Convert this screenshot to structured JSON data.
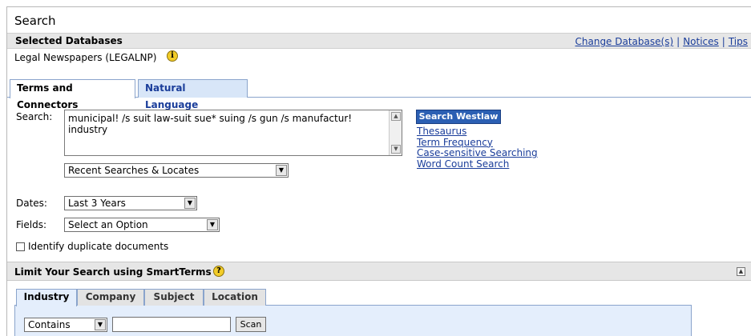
{
  "page": {
    "title": "Search"
  },
  "databases": {
    "header": "Selected Databases",
    "selected": "Legal Newspapers (LEGALNP)",
    "links": [
      "Change Database(s)",
      "Notices",
      "Tips"
    ]
  },
  "tabs": [
    {
      "label": "Terms and Connectors",
      "active": true
    },
    {
      "label": "Natural Language",
      "active": false
    }
  ],
  "search": {
    "label": "Search:",
    "query": "municipal! /s suit law-suit sue* suing /s gun /s manufactur!\nindustry",
    "button": "Search Westlaw",
    "links": [
      "Thesaurus",
      "Term Frequency",
      "Case-sensitive Searching",
      "Word Count Search"
    ],
    "recent_select": "Recent Searches & Locates"
  },
  "dates": {
    "label": "Dates:",
    "value": "Last 3 Years"
  },
  "fields": {
    "label": "Fields:",
    "value": "Select an Option"
  },
  "duplicate": {
    "label": "Identify duplicate documents",
    "checked": false
  },
  "smartterms": {
    "title": "Limit Your Search using SmartTerms",
    "tabs": [
      "Industry",
      "Company",
      "Subject",
      "Location"
    ],
    "active_tab": "Industry",
    "match_select": "Contains",
    "term_value": "",
    "scan_button": "Scan"
  },
  "colors": {
    "link": "#1a3d9a",
    "button": "#2b5fb3",
    "bar": "#e6e6e6",
    "tab_inactive": "#d8e6f8"
  },
  "icons": [
    "info-icon",
    "help-icon",
    "dropdown-arrow-icon",
    "collapse-icon"
  ]
}
